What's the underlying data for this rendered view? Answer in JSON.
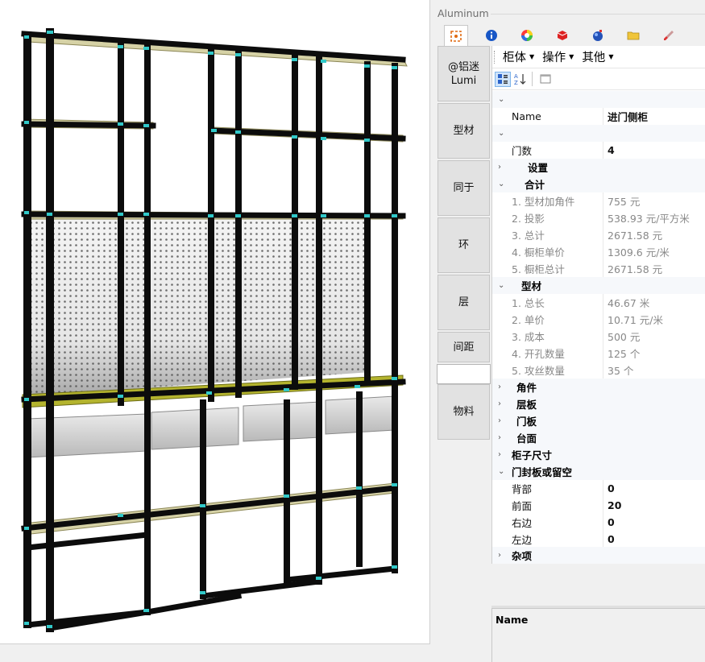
{
  "panel": {
    "title": "Aluminum",
    "tabs": [
      {
        "icon": "shape-tool-icon",
        "active": true
      },
      {
        "icon": "info-icon"
      },
      {
        "icon": "color-wheel-icon"
      },
      {
        "icon": "material-box-icon"
      },
      {
        "icon": "globe-icon"
      },
      {
        "icon": "folder-icon"
      },
      {
        "icon": "brush-icon"
      }
    ]
  },
  "sidebar": {
    "logo_line1": "@铝迷",
    "logo_line2": "Lumi",
    "buttons": [
      "型材",
      "同于",
      "环",
      "层",
      "间距",
      "物料"
    ]
  },
  "menu": {
    "items": [
      "柜体",
      "操作",
      "其他"
    ]
  },
  "properties": {
    "name_label": "Name",
    "name_value": "进门侧柜",
    "door_count_label": "门数",
    "door_count_value": "4",
    "settings_label": "设置",
    "total_label": "合计",
    "total_items": [
      {
        "label": "1. 型材加角件",
        "value": "755 元"
      },
      {
        "label": "2. 投影",
        "value": "538.93 元/平方米"
      },
      {
        "label": "3. 总计",
        "value": "2671.58 元"
      },
      {
        "label": "4. 橱柜单价",
        "value": "1309.6 元/米"
      },
      {
        "label": "5. 橱柜总计",
        "value": "2671.58 元"
      }
    ],
    "profile_label": "型材",
    "profile_items": [
      {
        "label": "1. 总长",
        "value": "46.67 米"
      },
      {
        "label": "2. 单价",
        "value": "10.71 元/米"
      },
      {
        "label": "3. 成本",
        "value": "500 元"
      },
      {
        "label": "4. 开孔数量",
        "value": "125 个"
      },
      {
        "label": "5. 攻丝数量",
        "value": "35 个"
      }
    ],
    "categories": [
      "角件",
      "层板",
      "门板",
      "台面",
      "柜子尺寸"
    ],
    "door_seal_label": "门封板或留空",
    "door_seal_items": [
      {
        "label": "背部",
        "value": "0"
      },
      {
        "label": "前面",
        "value": "20"
      },
      {
        "label": "右边",
        "value": "0"
      },
      {
        "label": "左边",
        "value": "0"
      }
    ],
    "misc_label": "杂项"
  },
  "description": {
    "title": "Name"
  }
}
